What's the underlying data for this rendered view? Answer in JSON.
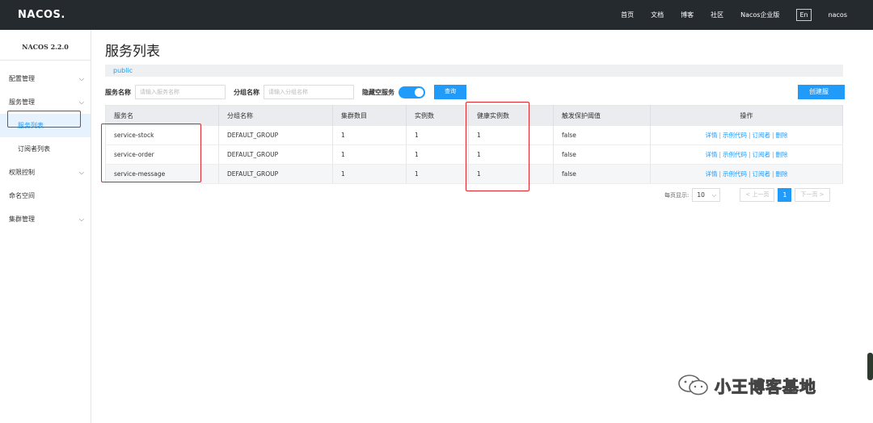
{
  "header": {
    "logo": "NACOS.",
    "nav": [
      "首页",
      "文档",
      "博客",
      "社区",
      "Nacos企业版"
    ],
    "lang": "En",
    "user": "nacos"
  },
  "sidebar": {
    "version": "NACOS 2.2.0",
    "items": [
      {
        "label": "配置管理",
        "chevron": "chevron-down-icon"
      },
      {
        "label": "服务管理",
        "chevron": "chevron-down-icon"
      },
      {
        "label": "服务列表",
        "active": true
      },
      {
        "label": "订阅者列表"
      },
      {
        "label": "权限控制",
        "chevron": "chevron-down-icon"
      },
      {
        "label": "命名空间"
      },
      {
        "label": "集群管理",
        "chevron": "chevron-down-icon"
      }
    ]
  },
  "main": {
    "title": "服务列表",
    "namespace": "public",
    "filters": {
      "service_label": "服务名称",
      "service_placeholder": "请输入服务名称",
      "group_label": "分组名称",
      "group_placeholder": "请输入分组名称",
      "hide_empty_label": "隐藏空服务",
      "query_button": "查询",
      "create_button": "创建服务"
    },
    "table": {
      "columns": [
        "服务名",
        "分组名称",
        "集群数目",
        "实例数",
        "健康实例数",
        "触发保护阈值",
        "操作"
      ],
      "rows": [
        [
          "service-stock",
          "DEFAULT_GROUP",
          "1",
          "1",
          "1",
          "false"
        ],
        [
          "service-order",
          "DEFAULT_GROUP",
          "1",
          "1",
          "1",
          "false"
        ],
        [
          "service-message",
          "DEFAULT_GROUP",
          "1",
          "1",
          "1",
          "false"
        ]
      ],
      "ops": [
        "详情",
        "示例代码",
        "订阅者",
        "删除"
      ],
      "op_separator": "|"
    },
    "pager": {
      "per_page_label": "每页显示:",
      "per_page_value": "10",
      "prev": "< 上一页",
      "current_page": "1",
      "next": "下一页 >"
    }
  },
  "watermark": {
    "text": "小王博客基地"
  },
  "colors": {
    "accent": "#209bfa",
    "topbar": "#252a2f",
    "highlight": "#e0262c"
  }
}
